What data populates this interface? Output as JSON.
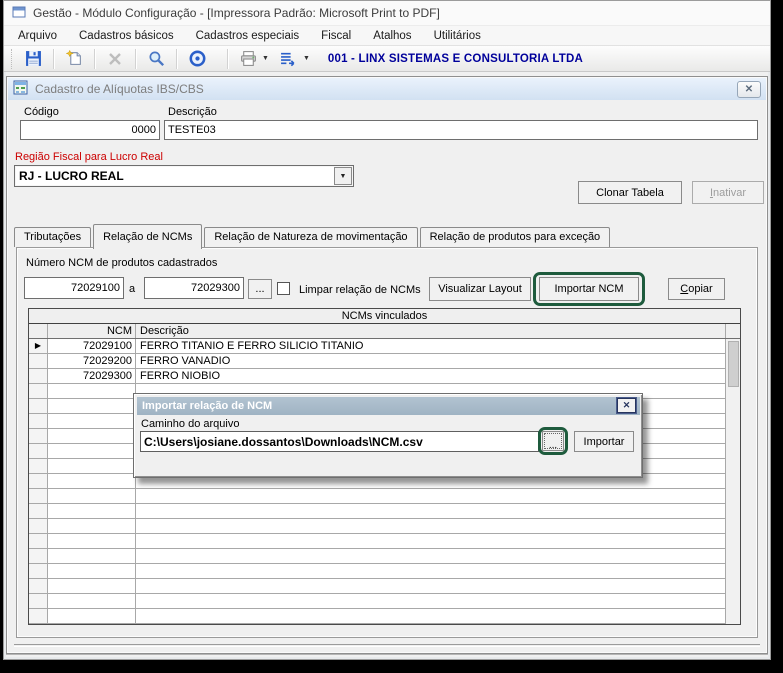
{
  "window": {
    "title": "Gestão  - Módulo Configuração - [Impressora Padrão: Microsoft Print to PDF]",
    "menu": [
      "Arquivo",
      "Cadastros básicos",
      "Cadastros especiais",
      "Fiscal",
      "Atalhos",
      "Utilitários"
    ],
    "toolbar": {
      "company": "001 - LINX SISTEMAS E CONSULTORIA LTDA"
    }
  },
  "form": {
    "title": "Cadastro de Alíquotas IBS/CBS",
    "codigo": {
      "label": "Código",
      "value": "0000"
    },
    "descricao": {
      "label": "Descrição",
      "value": "TESTE03"
    },
    "regiao": {
      "label": "Região Fiscal para Lucro Real",
      "value": "RJ - LUCRO REAL"
    },
    "buttons": {
      "clonar": "Clonar Tabela",
      "inativar": "Inativar"
    },
    "tabs": [
      "Tributações",
      "Relação de NCMs",
      "Relação de Natureza de movimentação",
      "Relação de produtos para exceção"
    ],
    "active_tab": "Relação de NCMs"
  },
  "ncm_section": {
    "label": "Número  NCM de produtos cadastrados",
    "range_from": "72029100",
    "range_sep": "a",
    "range_to": "72029300",
    "browse": "...",
    "checkbox_label": "Limpar relação de NCMs",
    "checkbox_checked": false,
    "buttons": {
      "visualizar": "Visualizar Layout",
      "importar": "Importar NCM",
      "copiar": "Copiar"
    }
  },
  "table": {
    "group_title": "NCMs vinculados",
    "columns": [
      "NCM",
      "Descrição"
    ],
    "rows": [
      {
        "ncm": "72029100",
        "descricao": "FERRO TITANIO E FERRO SILICIO TITANIO"
      },
      {
        "ncm": "72029200",
        "descricao": "FERRO VANADIO"
      },
      {
        "ncm": "72029300",
        "descricao": "FERRO NIOBIO"
      }
    ],
    "empty_rows": 16
  },
  "dialog": {
    "title": "Importar relação de NCM",
    "path_label": "Caminho do arquivo",
    "path_value": "C:\\Users\\josiane.dossantos\\Downloads\\NCM.csv",
    "browse": "...",
    "import_button": "Importar"
  },
  "icons": {
    "close": "✕",
    "dropdown": "▼",
    "row_selector": "▶"
  },
  "colors": {
    "company_text": "#00009b",
    "label_red": "#cc0000",
    "highlight_green": "#1e5b3d",
    "dialog_titlebar": "#a6b9c9",
    "form_caption": "#dbe7f6"
  }
}
